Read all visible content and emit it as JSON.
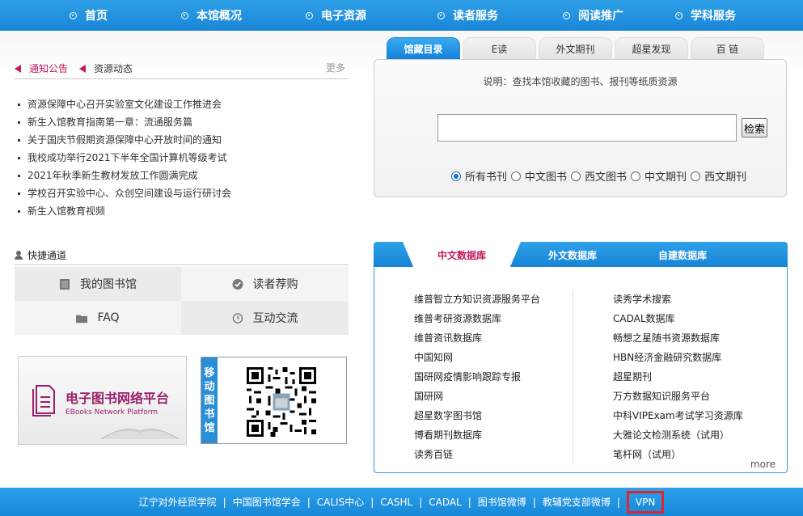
{
  "nav": {
    "items": [
      "首页",
      "本馆概况",
      "电子资源",
      "读者服务",
      "阅读推广",
      "学科服务"
    ]
  },
  "notice": {
    "tabs": [
      "通知公告",
      "资源动态"
    ],
    "more": "更多",
    "items": [
      "资源保障中心召开实验室文化建设工作推进会",
      "新生入馆教育指南第一章：流通服务篇",
      "关于国庆节假期资源保障中心开放时间的通知",
      "我校成功举行2021下半年全国计算机等级考试",
      "2021年秋季新生教材发放工作圆满完成",
      "学校召开实验中心、众创空间建设与运行研讨会",
      "新生入馆教育视频"
    ]
  },
  "quick": {
    "title": "快捷通道",
    "items": [
      "我的图书馆",
      "读者荐购",
      "FAQ",
      "互动交流"
    ]
  },
  "ebook": {
    "title": "电子图书网络平台",
    "subtitle": "EBooks Network Platform"
  },
  "mobile": {
    "label": [
      "移",
      "动",
      "图",
      "书",
      "馆"
    ]
  },
  "search": {
    "tabs": [
      "馆藏目录",
      "E读",
      "外文期刊",
      "超星发现",
      "百 链"
    ],
    "description": "说明：查找本馆收藏的图书、报刊等纸质资源",
    "input_value": "",
    "button": "检索",
    "options": [
      "所有书刊",
      "中文图书",
      "西文图书",
      "中文期刊",
      "西文期刊"
    ],
    "selected_option": "所有书刊"
  },
  "databases": {
    "tabs": [
      "中文数据库",
      "外文数据库",
      "自建数据库"
    ],
    "left": [
      "维普智立方知识资源服务平台",
      "维普考研资源数据库",
      "维普资讯数据库",
      "中国知网",
      "国研网疫情影响跟踪专报",
      "国研网",
      "超星数字图书馆",
      "博看期刊数据库",
      "读秀百链"
    ],
    "right": [
      "读秀学术搜索",
      "CADAL数据库",
      "畅想之星随书资源数据库",
      "HBN经济金融研究数据库",
      "超星期刊",
      "万方数据知识服务平台",
      "中科VIPExam考试学习资源库",
      "大雅论文检测系统（试用）",
      "笔杆网（试用）"
    ],
    "more": "more"
  },
  "footer": {
    "links": [
      "辽宁对外经贸学院",
      "中国图书馆学会",
      "CALIS中心",
      "CASHL",
      "CADAL",
      "图书馆微博",
      "教辅党支部微博",
      "VPN"
    ],
    "sep": "|"
  },
  "colors": {
    "primary_blue": "#1a86d6",
    "accent_magenta": "#c0185a",
    "highlight_red": "#e0262c"
  }
}
